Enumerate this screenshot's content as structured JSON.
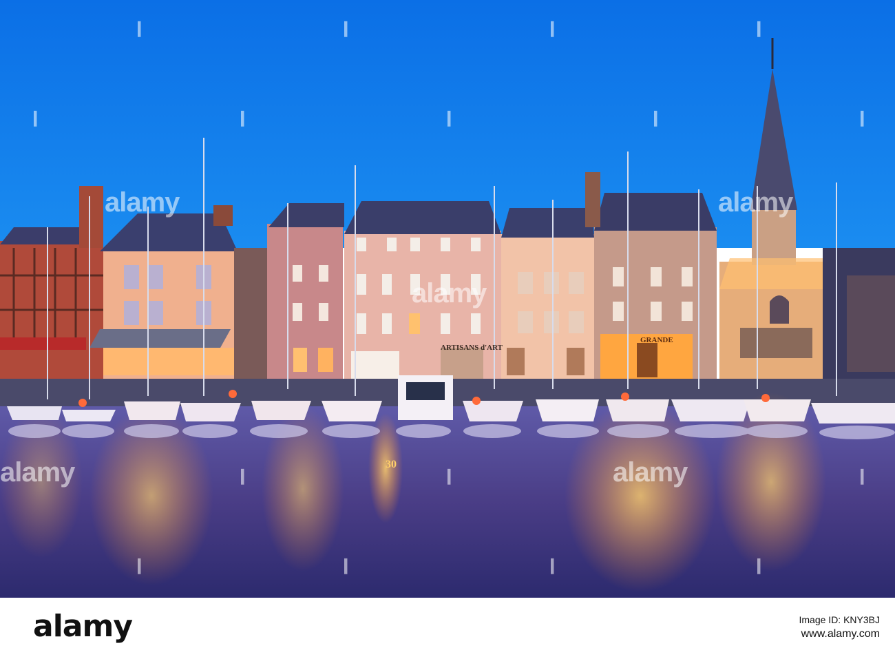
{
  "photo": {
    "colors": {
      "sky": "#0a73e8",
      "water": "#4a3a8a",
      "glow": "#ffb24a"
    },
    "shop_sign_1": "ARTISANS d'ART",
    "shop_sign_2": "GRANDE",
    "boat_number": "30",
    "watermark_text": "alamy"
  },
  "footer": {
    "logo": "alamy",
    "caption_line1": "Image ID: KNY3BJ",
    "caption_line2": "www.alamy.com"
  }
}
